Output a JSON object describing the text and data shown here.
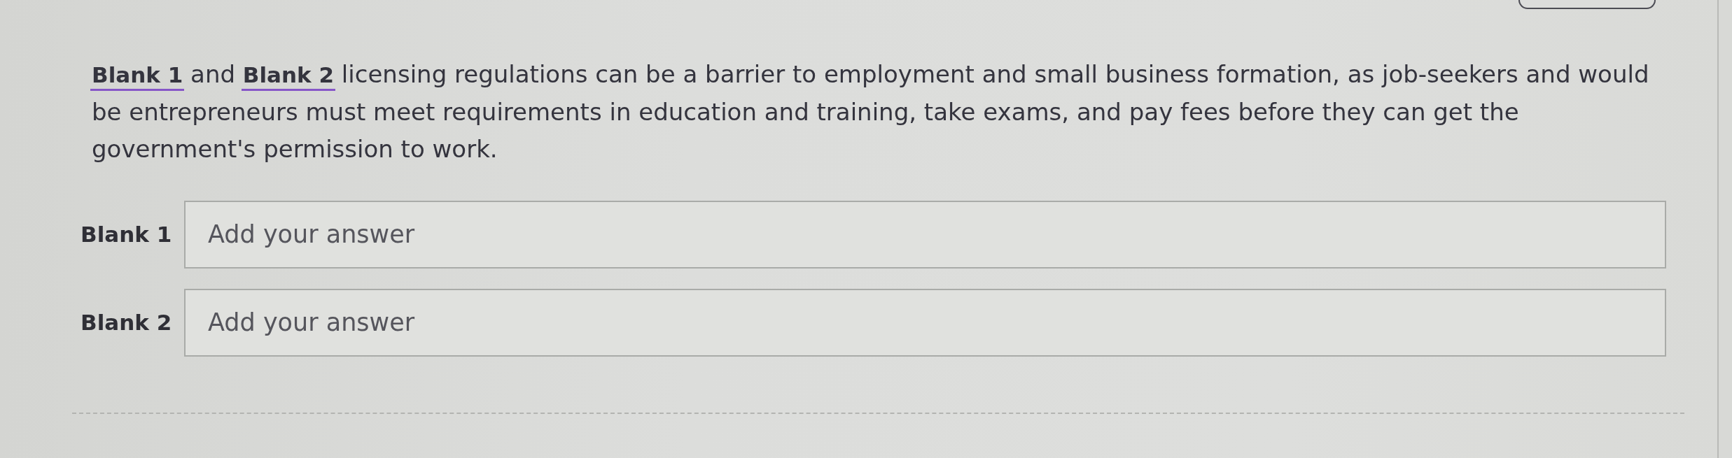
{
  "question": {
    "text": "**Blank 1** and **Blank 2** licensing regulations can be a barrier to employment and small business formation, as job-seekers and would be entrepreneurs must meet requirements in education and training, take exams, and pay fees before they can get the government's permission to work."
  },
  "answers": [
    {
      "label": "Blank 1",
      "placeholder": "Add your answer"
    },
    {
      "label": "Blank 2",
      "placeholder": "Add your answer"
    }
  ]
}
